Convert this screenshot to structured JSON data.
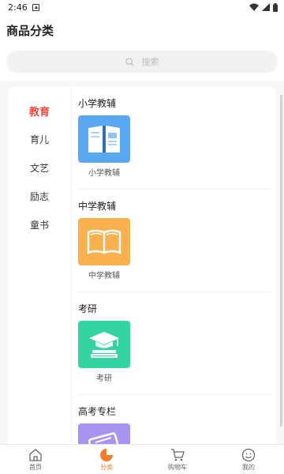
{
  "status_bar": {
    "time": "2:46"
  },
  "header": {
    "title": "商品分类"
  },
  "search": {
    "placeholder": "搜索"
  },
  "categories": [
    {
      "label": "教育",
      "active": true
    },
    {
      "label": "育儿",
      "active": false
    },
    {
      "label": "文艺",
      "active": false
    },
    {
      "label": "励志",
      "active": false
    },
    {
      "label": "童书",
      "active": false
    }
  ],
  "sections": [
    {
      "title": "小学教辅",
      "item_label": "小学教辅",
      "icon": "open-book-icon",
      "color": "#5aa9f0"
    },
    {
      "title": "中学教辅",
      "item_label": "中学教辅",
      "icon": "open-book-outline-icon",
      "color": "#f9b04f"
    },
    {
      "title": "考研",
      "item_label": "考研",
      "icon": "graduation-cap-books-icon",
      "color": "#34d3a2"
    },
    {
      "title": "高考专栏",
      "item_label": "",
      "icon": "exam-icon",
      "color": "#a993f0"
    }
  ],
  "bottom_nav": [
    {
      "label": "首页",
      "icon": "home-icon",
      "active": false
    },
    {
      "label": "分类",
      "icon": "category-icon",
      "active": true
    },
    {
      "label": "购物车",
      "icon": "cart-icon",
      "active": false
    },
    {
      "label": "我的",
      "icon": "profile-icon",
      "active": false
    }
  ],
  "colors": {
    "accent": "#ef4b3a",
    "nav_active": "#f07d28"
  }
}
